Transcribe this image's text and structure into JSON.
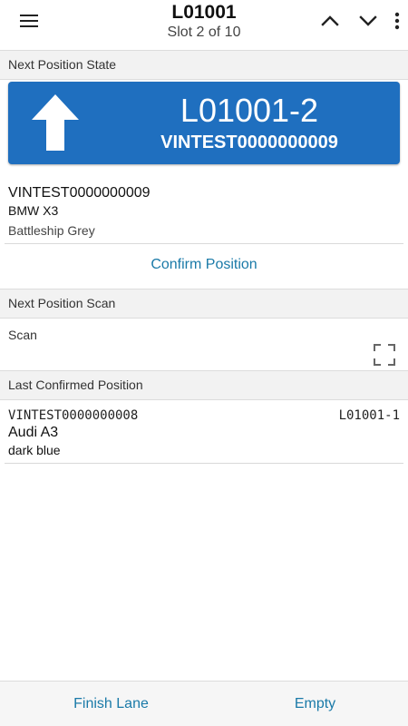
{
  "header": {
    "title": "L01001",
    "subtitle": "Slot 2 of 10",
    "icons": [
      "menu-icon",
      "chevron-up-icon",
      "chevron-down-icon",
      "more-vert-icon"
    ]
  },
  "next_position_state": {
    "section_label": "Next Position State",
    "direction_icon": "arrow-up-icon",
    "position": "L01001-2",
    "vin": "VINTEST0000000009",
    "vehicle": {
      "vin": "VINTEST0000000009",
      "model": "BMW X3",
      "color": "Battleship Grey"
    },
    "confirm_label": "Confirm Position"
  },
  "next_position_scan": {
    "section_label": "Next Position Scan",
    "scan_label": "Scan",
    "scan_icon": "scan-frame-icon"
  },
  "last_confirmed": {
    "section_label": "Last Confirmed Position",
    "vin": "VINTEST0000000008",
    "position": "L01001-1",
    "model": "Audi A3",
    "color": "dark blue"
  },
  "footer": {
    "finish_label": "Finish Lane",
    "empty_label": "Empty"
  },
  "colors": {
    "accent_blue": "#1f6fbf",
    "link_teal": "#1a7aa8"
  }
}
